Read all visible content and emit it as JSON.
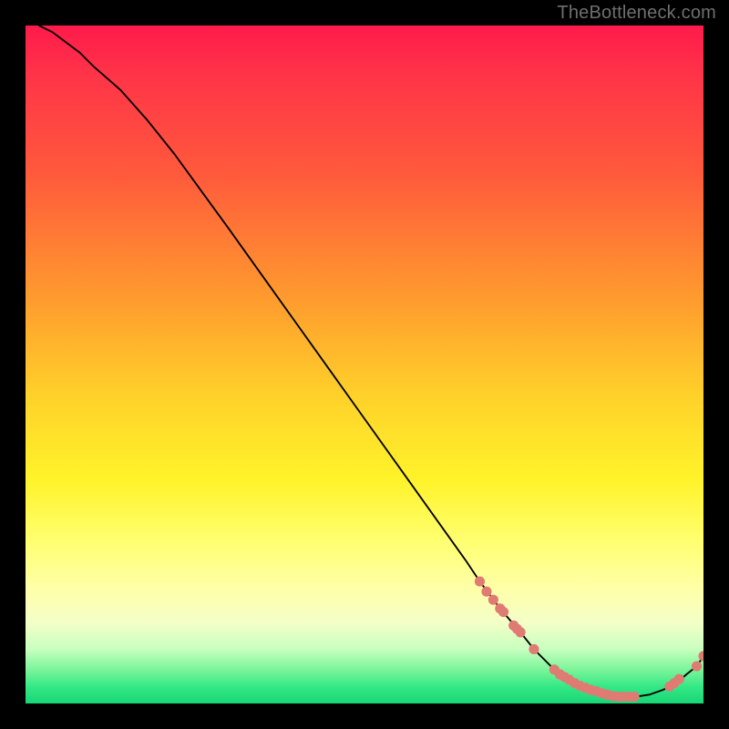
{
  "watermark": "TheBottleneck.com",
  "chart_data": {
    "type": "line",
    "title": "",
    "xlabel": "",
    "ylabel": "",
    "xlim": [
      0,
      100
    ],
    "ylim": [
      0,
      100
    ],
    "series": [
      {
        "name": "curve",
        "x": [
          2,
          4,
          6,
          8,
          10,
          14,
          18,
          22,
          26,
          30,
          35,
          40,
          45,
          50,
          55,
          60,
          65,
          67,
          70,
          73,
          75,
          78,
          80,
          82,
          85,
          88,
          90,
          92,
          94,
          96,
          97.5,
          99,
          100
        ],
        "y": [
          100,
          99,
          97.5,
          96,
          94,
          90.5,
          86,
          81,
          75.5,
          70,
          63,
          56,
          49,
          42,
          35,
          28,
          21,
          18,
          14,
          10.5,
          8,
          5,
          3.5,
          2.5,
          1.5,
          1,
          1,
          1.3,
          2,
          3,
          4.3,
          5.5,
          7
        ]
      }
    ],
    "highlight_clusters": [
      {
        "name": "upper-cluster",
        "points": [
          {
            "x": 67,
            "y": 18
          },
          {
            "x": 68,
            "y": 16.5
          },
          {
            "x": 69,
            "y": 15.3
          },
          {
            "x": 70,
            "y": 14
          },
          {
            "x": 70.5,
            "y": 13.5
          },
          {
            "x": 72,
            "y": 11.5
          },
          {
            "x": 72.5,
            "y": 11
          },
          {
            "x": 73,
            "y": 10.5
          },
          {
            "x": 75,
            "y": 8
          }
        ]
      },
      {
        "name": "valley-cluster-left",
        "points": [
          {
            "x": 78,
            "y": 5
          },
          {
            "x": 78.8,
            "y": 4.3
          },
          {
            "x": 79.5,
            "y": 3.9
          },
          {
            "x": 80.2,
            "y": 3.5
          },
          {
            "x": 81,
            "y": 3.0
          },
          {
            "x": 81.8,
            "y": 2.6
          },
          {
            "x": 82.6,
            "y": 2.3
          },
          {
            "x": 83.4,
            "y": 2.0
          },
          {
            "x": 84.2,
            "y": 1.8
          },
          {
            "x": 85,
            "y": 1.5
          },
          {
            "x": 85.8,
            "y": 1.3
          },
          {
            "x": 86.6,
            "y": 1.1
          },
          {
            "x": 87.4,
            "y": 1.0
          },
          {
            "x": 88.2,
            "y": 1.0
          },
          {
            "x": 89,
            "y": 1.0
          },
          {
            "x": 89.8,
            "y": 1.0
          }
        ]
      },
      {
        "name": "tail-cluster",
        "points": [
          {
            "x": 95,
            "y": 2.5
          },
          {
            "x": 95.7,
            "y": 3.0
          },
          {
            "x": 96.4,
            "y": 3.6
          }
        ]
      },
      {
        "name": "endpoint-pair",
        "points": [
          {
            "x": 99,
            "y": 5.5
          },
          {
            "x": 100,
            "y": 7
          }
        ]
      }
    ],
    "highlight_color": "#e07b74",
    "line_color": "#000000"
  }
}
